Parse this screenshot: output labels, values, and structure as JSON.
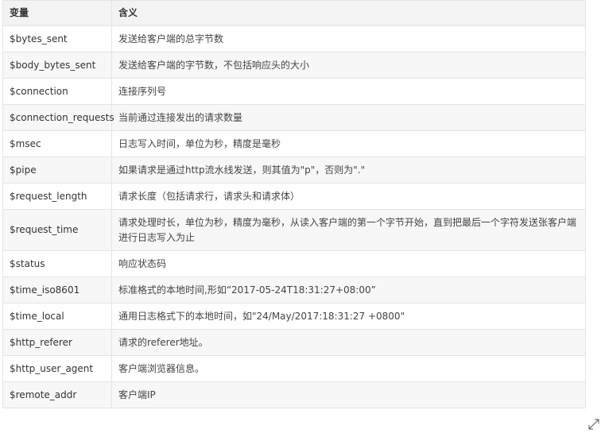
{
  "table": {
    "headers": [
      "变量",
      "含义"
    ],
    "rows": [
      [
        "$bytes_sent",
        "发送给客户端的总字节数"
      ],
      [
        "$body_bytes_sent",
        "发送给客户端的字节数，不包括响应头的大小"
      ],
      [
        "$connection",
        "连接序列号"
      ],
      [
        "$connection_requests",
        "当前通过连接发出的请求数量"
      ],
      [
        "$msec",
        "日志写入时间，单位为秒，精度是毫秒"
      ],
      [
        "$pipe",
        "如果请求是通过http流水线发送，则其值为\"p\"，否则为\".\""
      ],
      [
        "$request_length",
        "请求长度（包括请求行，请求头和请求体）"
      ],
      [
        "$request_time",
        "请求处理时长，单位为秒，精度为毫秒，从读入客户端的第一个字节开始，直到把最后一个字符发送张客户端进行日志写入为止"
      ],
      [
        "$status",
        "响应状态码"
      ],
      [
        "$time_iso8601",
        "标准格式的本地时间,形如“2017-05-24T18:31:27+08:00”"
      ],
      [
        "$time_local",
        "通用日志格式下的本地时间，如\"24/May/2017:18:31:27 +0800\""
      ],
      [
        "$http_referer",
        "请求的referer地址。"
      ],
      [
        "$http_user_agent",
        "客户端浏览器信息。"
      ],
      [
        "$remote_addr",
        "客户端IP"
      ]
    ]
  },
  "icons": {
    "resize": "resize-diagonal-icon"
  }
}
